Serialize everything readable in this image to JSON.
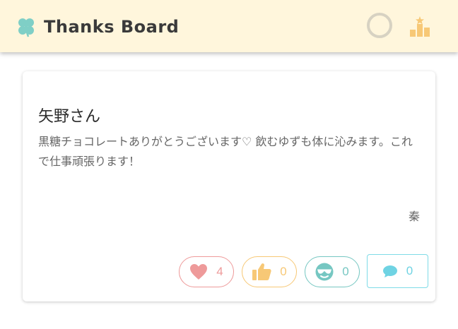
{
  "app": {
    "title": "Thanks Board",
    "colors": {
      "header_bg": "#fff6dc",
      "heart": "#ee9a9a",
      "like": "#f7c876",
      "cool": "#76c7c2",
      "comment": "#6fd3e3",
      "clover": "#7fcfc6"
    }
  },
  "header": {
    "logo_icon": "clover-icon",
    "avatar_icon": "user-avatar-ring",
    "ranking_icon": "podium-star-icon"
  },
  "card": {
    "to": "矢野さん",
    "message": "黒糖チョコレートありがとうございます♡ 飲むゆずも体に沁みます。これで仕事頑張ります！",
    "from": "秦",
    "reactions": {
      "heart": {
        "icon": "heart-icon",
        "count": "4"
      },
      "like": {
        "icon": "thumbs-up-icon",
        "count": "0"
      },
      "cool": {
        "icon": "sunglasses-face-icon",
        "count": "0"
      },
      "comment": {
        "icon": "speech-bubble-icon",
        "count": "0"
      }
    }
  }
}
